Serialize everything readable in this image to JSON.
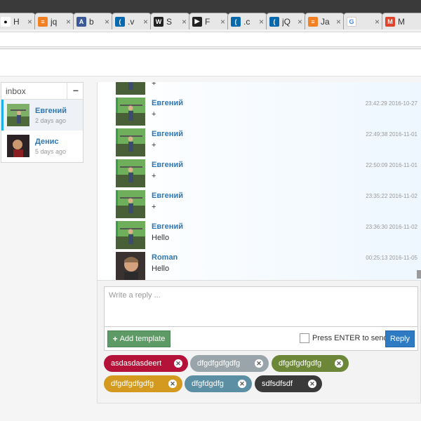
{
  "browser": {
    "tabs": [
      {
        "label": "H",
        "icon": "panda-icon",
        "color": "#333333"
      },
      {
        "label": "jq",
        "icon": "stack-icon",
        "color": "#f48024"
      },
      {
        "label": "b",
        "icon": "a-letter-icon",
        "color": "#3b5998"
      },
      {
        "label": ".v",
        "icon": "jquery-icon",
        "color": "#0769ad"
      },
      {
        "label": "S",
        "icon": "w-icon",
        "color": "#222222"
      },
      {
        "label": "F",
        "icon": "flag-icon",
        "color": "#222222"
      },
      {
        "label": ".c",
        "icon": "jquery-icon",
        "color": "#0769ad"
      },
      {
        "label": "jQ",
        "icon": "jquery-icon",
        "color": "#0769ad"
      },
      {
        "label": "Ja",
        "icon": "stack-icon",
        "color": "#f48024"
      },
      {
        "label": "",
        "icon": "google-icon",
        "color": "#4285f4"
      },
      {
        "label": "M",
        "icon": "m-icon",
        "color": "#e0452c"
      }
    ],
    "close_glyph": "×"
  },
  "inbox": {
    "title": "inbox",
    "collapse_glyph": "−",
    "conversations": [
      {
        "name": "Евгений",
        "time": "2 days ago",
        "active": true
      },
      {
        "name": "Денис",
        "time": "5 days ago",
        "active": false
      }
    ]
  },
  "messages": [
    {
      "name": "",
      "text": "+",
      "time": "",
      "avatar": "landscape"
    },
    {
      "name": "Евгений",
      "text": "+",
      "time": "23:42:29 2016-10-27",
      "avatar": "landscape"
    },
    {
      "name": "Евгений",
      "text": "+",
      "time": "22:49:38 2016-11-01",
      "avatar": "landscape"
    },
    {
      "name": "Евгений",
      "text": "+",
      "time": "22:50:09 2016-11-01",
      "avatar": "landscape"
    },
    {
      "name": "Евгений",
      "text": "+",
      "time": "23:35:22 2016-11-02",
      "avatar": "landscape"
    },
    {
      "name": "Евгений",
      "text": "Hello",
      "time": "23:36:30 2016-11-02",
      "avatar": "landscape"
    },
    {
      "name": "Roman",
      "text": "Hello",
      "time": "00:25:13 2016-11-05",
      "avatar": "portrait"
    }
  ],
  "composer": {
    "placeholder": "Write a reply ...",
    "add_template_label": "Add template",
    "enter_to_send_label": "Press ENTER to send",
    "enter_to_send_checked": false,
    "reply_label": "Reply"
  },
  "tags": [
    {
      "label": "asdasdasdeert",
      "color": "#b5123a"
    },
    {
      "label": "dfgdfgdfgdfg",
      "color": "#9aa5ab"
    },
    {
      "label": "dfgdfgdfgdfg",
      "color": "#6b8737"
    },
    {
      "label": "dfgdfgdfgdfg",
      "color": "#d39a1f"
    },
    {
      "label": "dfgfdgdfg",
      "color": "#5c8fa3"
    },
    {
      "label": "sdfsdfsdf",
      "color": "#3a3a3a"
    }
  ]
}
